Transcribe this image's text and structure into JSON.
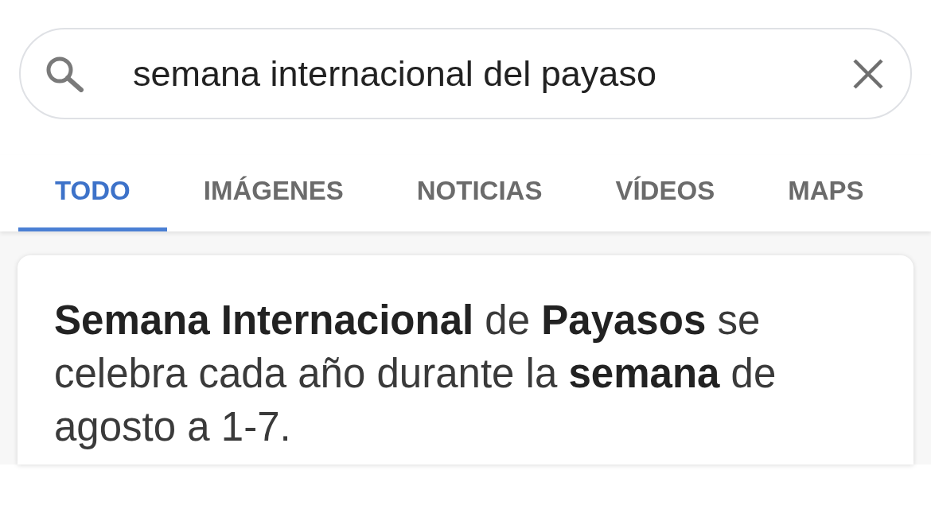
{
  "search": {
    "value": "semana internacional del payaso"
  },
  "tabs": [
    {
      "label": "TODO",
      "selected": true
    },
    {
      "label": "IMÁGENES",
      "selected": false
    },
    {
      "label": "NOTICIAS",
      "selected": false
    },
    {
      "label": "VÍDEOS",
      "selected": false
    },
    {
      "label": "MAPS",
      "selected": false
    }
  ],
  "result_card": {
    "text": "**Semana Internacional** de **Payasos** se celebra cada año durante la **semana** de agosto a 1-7."
  }
}
